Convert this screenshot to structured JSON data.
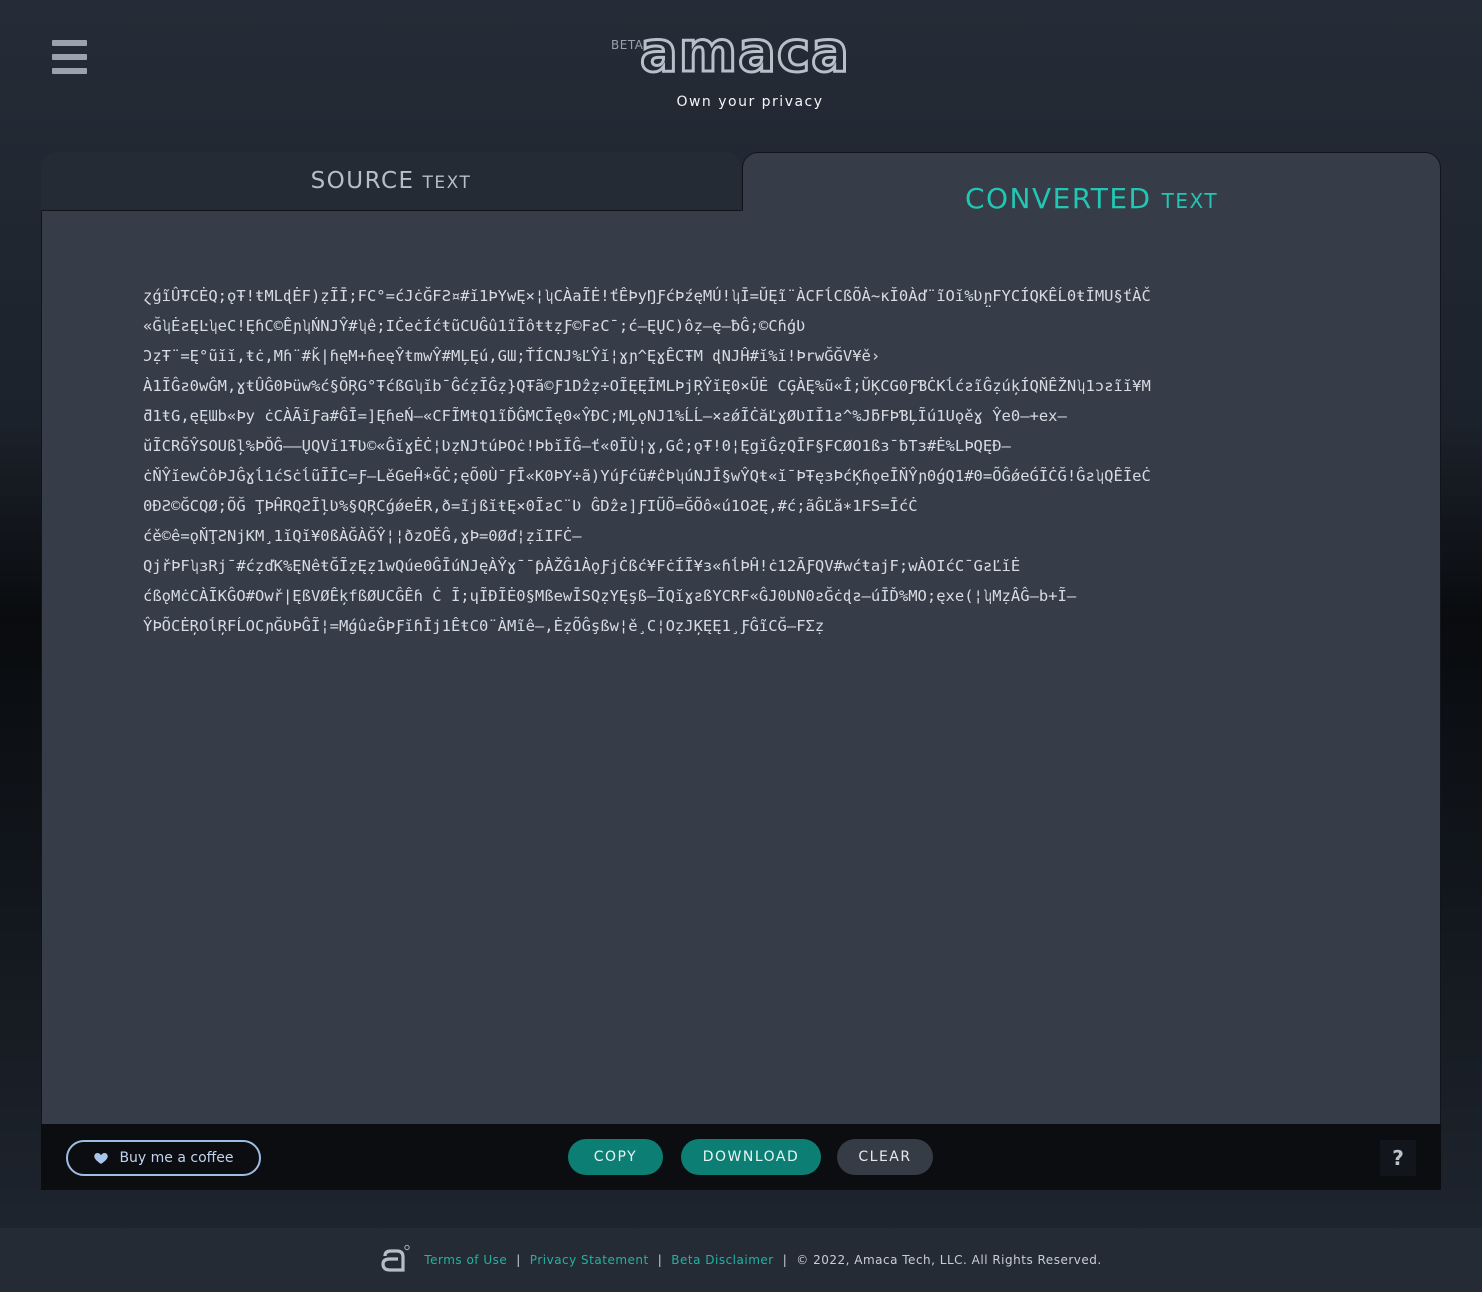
{
  "header": {
    "beta_tag": "BETA",
    "logo_text": "amaca",
    "tagline": "Own your privacy",
    "menu_icon": "hamburger-menu-icon"
  },
  "tabs": {
    "source": {
      "main": "SOURCE",
      "small": "TEXT"
    },
    "converted": {
      "main": "CONVERTED",
      "small": "TEXT"
    }
  },
  "converted_text": "ɀǵĩÛŦCĖQ;ǫŦ!ŧMLɖĖF)ẓĨĪ;FC°=ćJċĞFƧ¤#ĭ1ÞYwĘ×¦ʮCÀaĨĖ!ťÊÞyŊƑćÞźęMÚ!ʮĪ=ŬĘĩ¨ÀCFĺCßÕÀ~ĸĬ0Àď¨ĩOĭ%Ʋɲ̤FYCÍQKÊĹ0ŧĬMU§ťÀČ\n«ĞʮĖƨĘĿʮeC!ĘɦC©ÊɲʮŃNJŶ#ʮê;IĊeċÍćŧũCUĜû1ĩĬôŧŧẓƑ©FƨC¯;ć–ĘŲC)ôẓ–ę–ƀĜ;©CɦģƲ\nƆẓŦ¨=Ę°ũĭĭ,ŧċ,Mɦ¨#ǩ|ɦęM+ɦeęŶŧmwŶ#MĻĘú,GƜ;ŤÍCNJ%ĽŶĭ¦ɣɲ^ĘɣÊCŦM ɖNJĤ#ĭ%ĭ!ÞrwĞĞV¥ě›\nÀ1ĨĜƨ0wĜM,ɣŧÛĜ0Þüw%ć§ŎŖG°ŦćßGʮĭb¯ĜćẓĬĜẓ}QŦã©Ƒ1Dẑẓ÷OĨĘĘĪMLÞjŖŶĭĘ0×ŨĖ CĢÀĘ%ũ«Î;ŬĶCG0ƑƁĊKĺćƨĩĜẓúķÍQŇÊŽNʮ1ɔƨĩĭ¥M\nƌ1ŧG,ęĘƜb«Þy ċCÀÃĭƑa#ĜĪ=]ĘɦeŃ–«CFĨMŧQ1ĩĎĜMCĨę0«ŶĐC;MĻǫNJ1%ĹĹ–×ƨǿĨĊăĽɣØƲIĬ1ƨ^%JƃFÞƁĻĨú1Uǫěɣ Ŷe0–+ex–\nŭĨCRĞŶSOUßļ%ÞŎĜ––ŲQVĭ1ŦƲ©«ĜĭɣĖĊ¦ƲẓNJtúÞOċ!ÞbĭĬĜ–ť«0ĨÙ¦ɣ,Gĉ;ǫŦ!0¦ĘgĭĜẓQĪF§FCØO1ßɜ¯ƀTɜ#Ė%LÞQĘĐ–\nċŇŶĭewĊôÞJĜɣĺ1ćSċĺũĨĪC=Ƒ–LěGeĤ∗ĞĊ;ęÕ0Ù¯ƑĪ«K0ÞY÷ã)YúƑćũ#ĉÞʮúNJĪ§wŶQŧ«ĭ¯ÞŦęɜÞćĶɦǫeĪŇŶɲ0ǵQ1#0=ÕĜǿeǴĨĊĞ!ĜƨʮQÊĨeĊ\n0ĐƧ©ĞCQØ;ÕĞ ŢÞĤRQƧĨļƲ%§QŖCǵǿeĖR,ð=ĩjßĭŧĘ×0ĨƨC¨Ʋ ĜDẑƨ]ƑIŨÕ=ĞÕô«ú1OƧĘ,#ć;ãĜĽă∗1FS=ĪćĊ\nćě©ê=ǫŇŢƧNjKM¸1ĭQĭ¥0ßÀĞÀĞŶ¦¦ðzOĚĜ,ɣÞ=0Øď¦ẓĭIFĊ–\nQjřÞFʮɜRj¯#ćẓďK%ĘNêŧĞĨẓĘẓ1wQúe0ĜĪúNJęÀŶɣ¯¯ƥÀŽĜ1ÀǫƑjĊßć¥FċÍĨ¥ɜ«ɦĺÞĤ!ċ12ÃƑQV#wćŧajF;wÀOIćC¯GƨĽĭĖ\nćßǫMċCÀĨKĜO#Owř|ĘßVØÊķfßØUCĜÊɦ Ċ Ĩ;ɥĨĐĨĖ0§MßewĪSQẓYĘşß–ĨQĭɣƨßYCRF«ĜJ0ƲN0ƨĞċɖƨ–úĪĎ%MO;ęxe(¦ʮMẓÂĜ–b+Ĩ–\nŶÞÕCĖŖOĺŖFĹOCɲĞƲÞĜĨ¦=MǵûƨĜÞƑĭɦĪj1ÊŧC0¨ÀMĩê–,ĖẓÕĜşßw¦ě¸C¦OẓJĶĘĘ1¸ƑĜĩCĞ–FƩẓ",
  "toolbar": {
    "coffee_label": "Buy me a coffee",
    "coffee_icon": "heart-icon",
    "copy_label": "COPY",
    "download_label": "DOWNLOAD",
    "clear_label": "CLEAR",
    "help_label": "?"
  },
  "footer": {
    "logo_icon": "amaca-logo-icon",
    "terms": "Terms of Use",
    "privacy": "Privacy Statement",
    "beta": "Beta Disclaimer",
    "separator": "|",
    "copyright": "© 2022, Amaca Tech, LLC. All Rights Reserved."
  },
  "colors": {
    "accent": "#22c6b2",
    "button_teal": "#0c7e74",
    "link": "#1fb3a4",
    "panel": "#363d48",
    "coffee_border": "#9fbde2"
  }
}
